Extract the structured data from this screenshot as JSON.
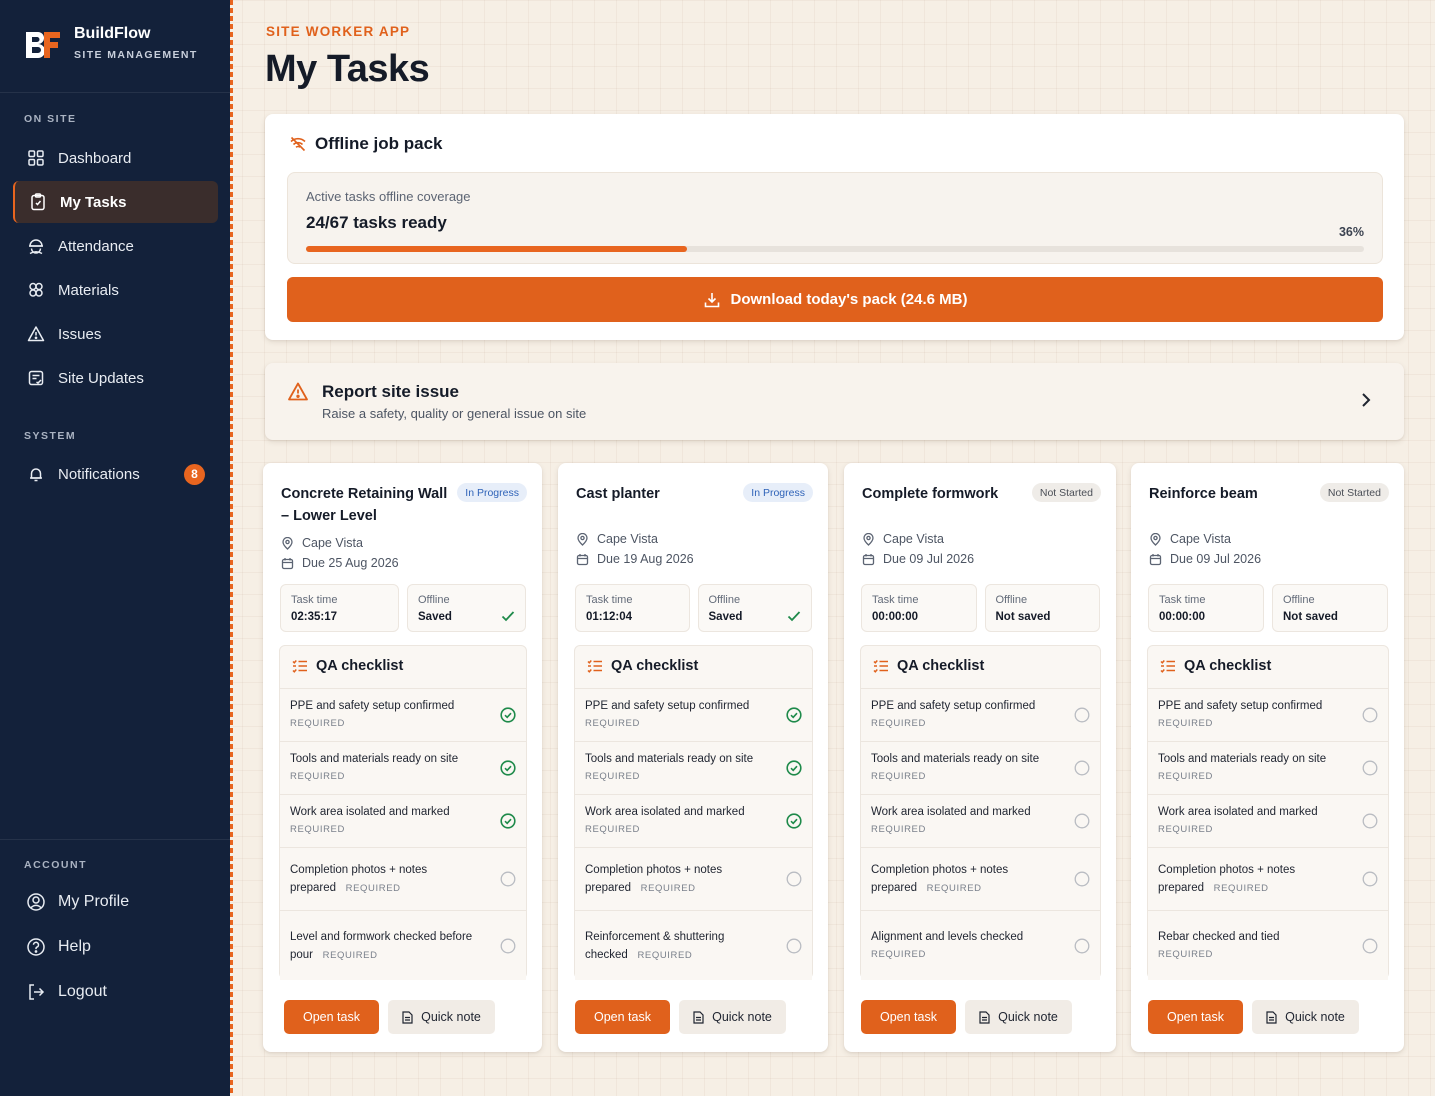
{
  "brand": {
    "name": "BuildFlow",
    "subtitle": "SITE MANAGEMENT",
    "logo_text": "BF",
    "accent_color": "#e8651f",
    "sidebar_color": "#13213a"
  },
  "sidebar": {
    "on_site_label": "ON SITE",
    "items": [
      {
        "label": "Dashboard",
        "icon": "dashboard-icon"
      },
      {
        "label": "My Tasks",
        "icon": "clipboard-icon",
        "active": true
      },
      {
        "label": "Attendance",
        "icon": "worker-icon"
      },
      {
        "label": "Materials",
        "icon": "materials-icon"
      },
      {
        "label": "Issues",
        "icon": "warning-icon"
      },
      {
        "label": "Site Updates",
        "icon": "updates-icon"
      }
    ],
    "system_label": "SYSTEM",
    "notifications": {
      "label": "Notifications",
      "icon": "bell-icon",
      "badge": "8"
    },
    "account_label": "ACCOUNT",
    "account_items": [
      {
        "label": "My Profile",
        "icon": "user-icon"
      },
      {
        "label": "Help",
        "icon": "help-icon"
      },
      {
        "label": "Logout",
        "icon": "logout-icon"
      }
    ]
  },
  "header": {
    "eyebrow": "SITE WORKER APP",
    "title": "My Tasks"
  },
  "offline_pack": {
    "title": "Offline job pack",
    "coverage_label": "Active tasks offline coverage",
    "coverage_value": "24/67 tasks ready",
    "percent_label": "36%",
    "progress_fraction": 0.36,
    "download_label": "Download today's pack (24.6 MB)"
  },
  "report_issue": {
    "title": "Report site issue",
    "subtitle": "Raise a safety, quality or general issue on site"
  },
  "labels": {
    "task_time": "Task time",
    "offline": "Offline",
    "qa_checklist": "QA checklist",
    "required": "REQUIRED",
    "open_task": "Open task",
    "quick_note": "Quick note"
  },
  "tasks": [
    {
      "title": "Concrete Retaining Wall – Lower Level",
      "status": "In Progress",
      "location": "Cape Vista",
      "due": "Due 25 Aug 2026",
      "task_time": "02:35:17",
      "offline_status": "Saved",
      "checklist": [
        {
          "line1": "PPE and safety setup confirmed",
          "line2": "",
          "done": true
        },
        {
          "line1": "Tools and materials ready on site",
          "line2": "",
          "done": true
        },
        {
          "line1": "Work area isolated and marked",
          "line2": "",
          "done": true
        },
        {
          "line1": "Completion photos + notes",
          "line2": "prepared",
          "done": false
        },
        {
          "line1": "Level and formwork checked before",
          "line2": "pour",
          "done": false
        }
      ]
    },
    {
      "title": "Cast planter",
      "status": "In Progress",
      "location": "Cape Vista",
      "due": "Due 19 Aug 2026",
      "task_time": "01:12:04",
      "offline_status": "Saved",
      "checklist": [
        {
          "line1": "PPE and safety setup confirmed",
          "line2": "",
          "done": true
        },
        {
          "line1": "Tools and materials ready on site",
          "line2": "",
          "done": true
        },
        {
          "line1": "Work area isolated and marked",
          "line2": "",
          "done": true
        },
        {
          "line1": "Completion photos + notes",
          "line2": "prepared",
          "done": false
        },
        {
          "line1": "Reinforcement & shuttering",
          "line2": "checked",
          "done": false
        }
      ]
    },
    {
      "title": "Complete formwork",
      "status": "Not Started",
      "location": "Cape Vista",
      "due": "Due 09 Jul 2026",
      "task_time": "00:00:00",
      "offline_status": "Not saved",
      "checklist": [
        {
          "line1": "PPE and safety setup confirmed",
          "line2": "",
          "done": false
        },
        {
          "line1": "Tools and materials ready on site",
          "line2": "",
          "done": false
        },
        {
          "line1": "Work area isolated and marked",
          "line2": "",
          "done": false
        },
        {
          "line1": "Completion photos + notes",
          "line2": "prepared",
          "done": false
        },
        {
          "line1": "Alignment and levels checked",
          "line2": "",
          "done": false
        }
      ]
    },
    {
      "title": "Reinforce beam",
      "status": "Not Started",
      "location": "Cape Vista",
      "due": "Due 09 Jul 2026",
      "task_time": "00:00:00",
      "offline_status": "Not saved",
      "checklist": [
        {
          "line1": "PPE and safety setup confirmed",
          "line2": "",
          "done": false
        },
        {
          "line1": "Tools and materials ready on site",
          "line2": "",
          "done": false
        },
        {
          "line1": "Work area isolated and marked",
          "line2": "",
          "done": false
        },
        {
          "line1": "Completion photos + notes",
          "line2": "prepared",
          "done": false
        },
        {
          "line1": "Rebar checked and tied",
          "line2": "",
          "done": false
        }
      ]
    }
  ]
}
